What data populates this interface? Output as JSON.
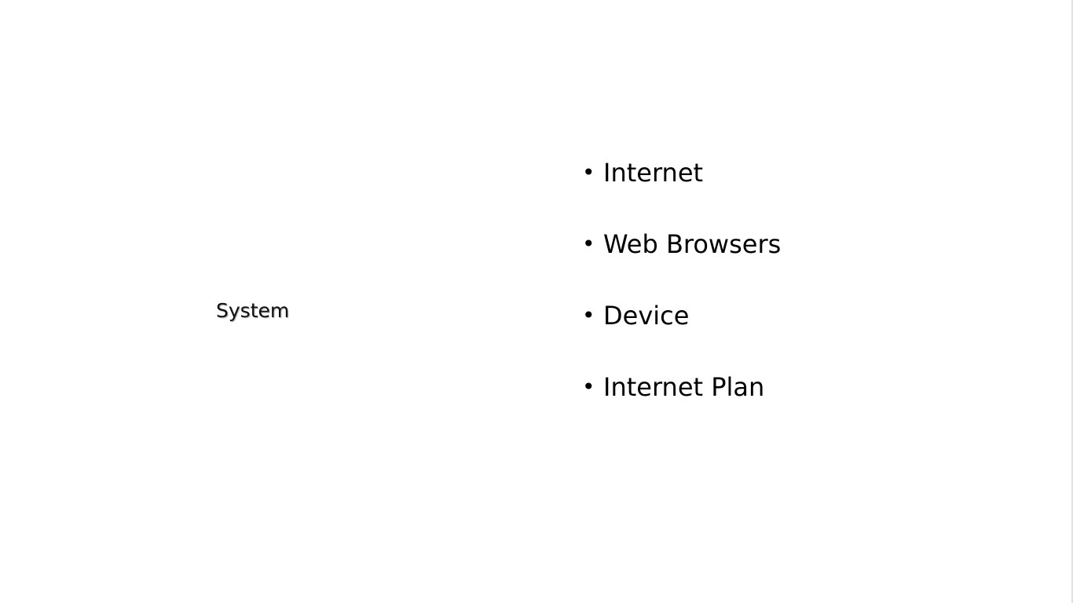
{
  "slide": {
    "title": "System",
    "bullet_glyph": "•",
    "bullets": [
      {
        "label": "Internet"
      },
      {
        "label": "Web Browsers"
      },
      {
        "label": "Device"
      },
      {
        "label": "Internet Plan"
      }
    ]
  },
  "colors": {
    "background": "#ffffff",
    "text": "#000000"
  }
}
